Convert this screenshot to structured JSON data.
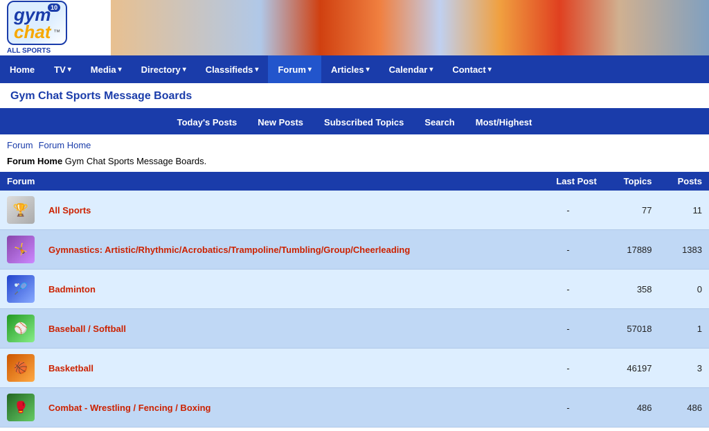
{
  "header": {
    "logo": {
      "text_gym": "gym",
      "text_chat": "chat",
      "tm": "™",
      "badge": "10",
      "allsports": "ALL SPORTS"
    }
  },
  "nav": {
    "items": [
      {
        "label": "Home",
        "arrow": false,
        "active": false
      },
      {
        "label": "TV",
        "arrow": true,
        "active": false
      },
      {
        "label": "Media",
        "arrow": true,
        "active": false
      },
      {
        "label": "Directory",
        "arrow": true,
        "active": false
      },
      {
        "label": "Classifieds",
        "arrow": true,
        "active": false
      },
      {
        "label": "Forum",
        "arrow": true,
        "active": true
      },
      {
        "label": "Articles",
        "arrow": true,
        "active": false
      },
      {
        "label": "Calendar",
        "arrow": true,
        "active": false
      },
      {
        "label": "Contact",
        "arrow": true,
        "active": false
      }
    ]
  },
  "page_title": "Gym Chat Sports Message Boards",
  "toolbar": {
    "items": [
      {
        "label": "Today's Posts"
      },
      {
        "label": "New Posts"
      },
      {
        "label": "Subscribed Topics"
      },
      {
        "label": "Search"
      },
      {
        "label": "Most/Highest"
      }
    ]
  },
  "breadcrumb": {
    "links": [
      "Forum",
      "Forum Home"
    ]
  },
  "forum_home_label": "Forum Home",
  "forum_home_desc": "Gym Chat Sports Message Boards.",
  "table": {
    "headers": [
      "Forum",
      "Last Post",
      "Topics",
      "Posts"
    ],
    "rows": [
      {
        "icon": "allsports",
        "icon_glyph": "🏆",
        "name": "All Sports",
        "last_post": "-",
        "topics": "77",
        "posts": "11"
      },
      {
        "icon": "gymnastics",
        "icon_glyph": "🤸",
        "name": "Gymnastics: Artistic/Rhythmic/Acrobatics/Trampoline/Tumbling/Group/Cheerleading",
        "last_post": "-",
        "topics": "17889",
        "posts": "1383"
      },
      {
        "icon": "badminton",
        "icon_glyph": "🏸",
        "name": "Badminton",
        "last_post": "-",
        "topics": "358",
        "posts": "0"
      },
      {
        "icon": "baseball",
        "icon_glyph": "⚾",
        "name": "Baseball / Softball",
        "last_post": "-",
        "topics": "57018",
        "posts": "1"
      },
      {
        "icon": "basketball",
        "icon_glyph": "🏀",
        "name": "Basketball",
        "last_post": "-",
        "topics": "46197",
        "posts": "3"
      },
      {
        "icon": "combat",
        "icon_glyph": "🥊",
        "name": "Combat - Wrestling / Fencing / Boxing",
        "last_post": "-",
        "topics": "486",
        "posts": "486"
      }
    ]
  }
}
